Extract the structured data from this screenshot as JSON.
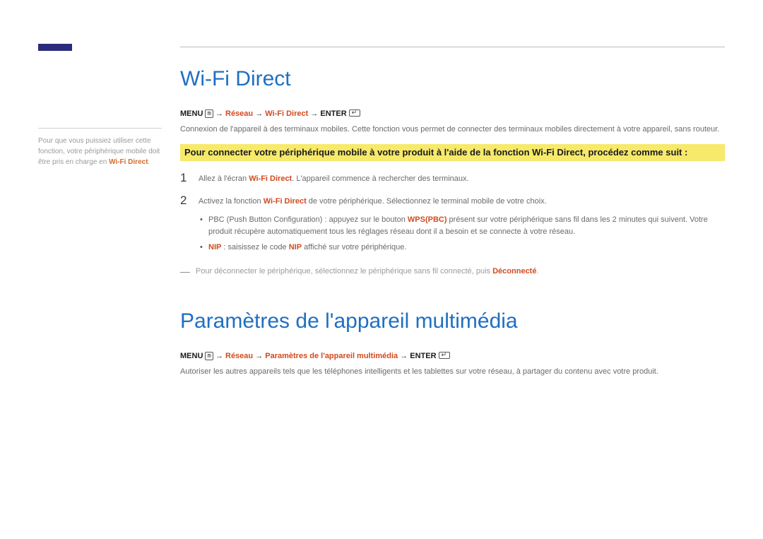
{
  "sidebar": {
    "note_pre": "Pour que vous puissiez utiliser cette fonction, votre périphérique mobile doit être pris en charge en ",
    "note_accent": "Wi-Fi Direct"
  },
  "section1": {
    "title": "Wi-Fi Direct",
    "nav": {
      "menu": "MENU",
      "arrow1": " → ",
      "reseau": "Réseau",
      "arrow2": " → ",
      "item": "Wi-Fi Direct",
      "arrow3": " → ",
      "enter": "ENTER"
    },
    "desc": "Connexion de l'appareil à des terminaux mobiles. Cette fonction vous permet de connecter des terminaux mobiles directement à votre appareil, sans routeur.",
    "highlight": "Pour connecter votre périphérique mobile à votre produit à l'aide de la fonction Wi-Fi Direct, procédez comme suit :",
    "step1": {
      "num": "1",
      "pre": "Allez à l'écran ",
      "red": "Wi-Fi Direct",
      "post": ". L'appareil commence à rechercher des terminaux."
    },
    "step2": {
      "num": "2",
      "pre": "Activez la fonction ",
      "red": "Wi-Fi Direct",
      "post": " de votre périphérique. Sélectionnez le terminal mobile de votre choix.",
      "bullet1_pre": "PBC (Push Button Configuration) : appuyez sur le bouton ",
      "bullet1_red": "WPS(PBC)",
      "bullet1_post": " présent sur votre périphérique sans fil dans les 2 minutes qui suivent. Votre produit récupère automatiquement tous les réglages réseau dont il a besoin et se connecte à votre réseau.",
      "bullet2_red": "NIP",
      "bullet2_mid": " : saisissez le code ",
      "bullet2_red2": "NIP",
      "bullet2_post": " affiché sur votre périphérique."
    },
    "note": {
      "dash": "―",
      "pre": "Pour déconnecter le périphérique, sélectionnez le périphérique sans fil connecté, puis ",
      "red": "Déconnecté",
      "post": "."
    }
  },
  "section2": {
    "title": "Paramètres de l'appareil multimédia",
    "nav": {
      "menu": "MENU",
      "arrow1": " → ",
      "reseau": "Réseau",
      "arrow2": " → ",
      "item": "Paramètres de l'appareil multimédia",
      "arrow3": " → ",
      "enter": "ENTER"
    },
    "desc": "Autoriser les autres appareils tels que les téléphones intelligents et les tablettes sur votre réseau, à partager du contenu avec votre produit."
  }
}
